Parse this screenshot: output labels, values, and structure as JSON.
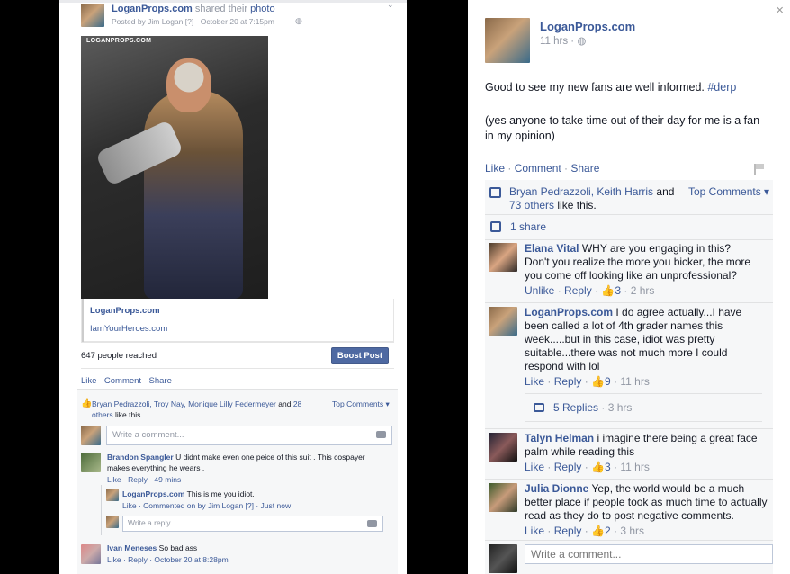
{
  "left": {
    "post": {
      "page_name": "LoganProps.com",
      "action_text": "shared their",
      "photo_link": "photo",
      "posted_by_line": "Posted by Jim Logan [?] · October 20 at 7:15pm ·",
      "image_badge": "LOGANPROPS.COM",
      "link_title": "LoganProps.com",
      "link_url": "IamYourHeroes.com",
      "reach_text": "647 people reached",
      "boost_label": "Boost Post",
      "actions": [
        "Like",
        "Comment",
        "Share"
      ],
      "likes_names": "Bryan Pedrazzoli, Troy Nay, Monique Lilly Federmeyer",
      "likes_and": "and",
      "likes_others_1": "28",
      "likes_others_2": "others",
      "likes_suffix": "like this.",
      "top_comments": "Top Comments ▾",
      "write_comment_placeholder": "Write a comment...",
      "comments": [
        {
          "author": "Brandon Spangler",
          "text_1": "U didnt make even one peice of this suit . This cospayer",
          "text_2": "makes everything he wears .",
          "meta": "Like · Reply · 49 mins"
        },
        {
          "author": "LoganProps.com",
          "text_1": "This is me you idiot.",
          "meta": "Like · Commented on by Jim Logan [?] · Just now"
        },
        {
          "author": "Ivan Meneses",
          "text_1": "So bad ass",
          "meta": "Like · Reply · October 20 at 8:28pm"
        }
      ],
      "write_reply_placeholder": "Write a reply..."
    }
  },
  "right": {
    "page_name": "LoganProps.com",
    "time": "11 hrs ·",
    "body_1_text": "Good to see my new fans are well informed.",
    "body_1_tag": "#derp",
    "body_2_line_1": "(yes anyone to take time out of their day for me is a fan",
    "body_2_line_2": "in my opinion)",
    "actions": [
      "Like",
      "Comment",
      "Share"
    ],
    "likes_names": "Bryan Pedrazzoli, Keith Harris",
    "likes_and": "and",
    "likes_others": "73 others",
    "likes_suffix": "like this.",
    "top_comments": "Top Comments ▾",
    "shares": "1 share",
    "comments": [
      {
        "author": "Elana Vital",
        "lines": [
          "WHY are you engaging in this?",
          "Don't you realize the more you bicker, the more",
          "you come off looking like an unprofessional?"
        ],
        "meta_action": "Unlike",
        "meta_reply": "Reply",
        "meta_likes": "3",
        "meta_time": "2 hrs"
      },
      {
        "author": "LoganProps.com",
        "lines": [
          "I do agree actually...I have",
          "been called a lot of 4th grader names this",
          "week.....but in this case, idiot was pretty",
          "suitable...there was not much more I could",
          "respond with lol"
        ],
        "meta_action": "Like",
        "meta_reply": "Reply",
        "meta_likes": "9",
        "meta_time": "11 hrs",
        "replies_label": "5 Replies",
        "replies_time": "3 hrs"
      },
      {
        "author": "Talyn Helman",
        "lines": [
          "i imagine there being a great face",
          "palm while reading this"
        ],
        "meta_action": "Like",
        "meta_reply": "Reply",
        "meta_likes": "3",
        "meta_time": "11 hrs"
      },
      {
        "author": "Julia Dionne",
        "lines": [
          "Yep, the world would be a much",
          "better place if people took as much time to actually",
          "read as they do to post negative comments."
        ],
        "meta_action": "Like",
        "meta_reply": "Reply",
        "meta_likes": "2",
        "meta_time": "3 hrs"
      }
    ],
    "write_comment_placeholder": "Write a comment...",
    "close_glyph": "×"
  }
}
